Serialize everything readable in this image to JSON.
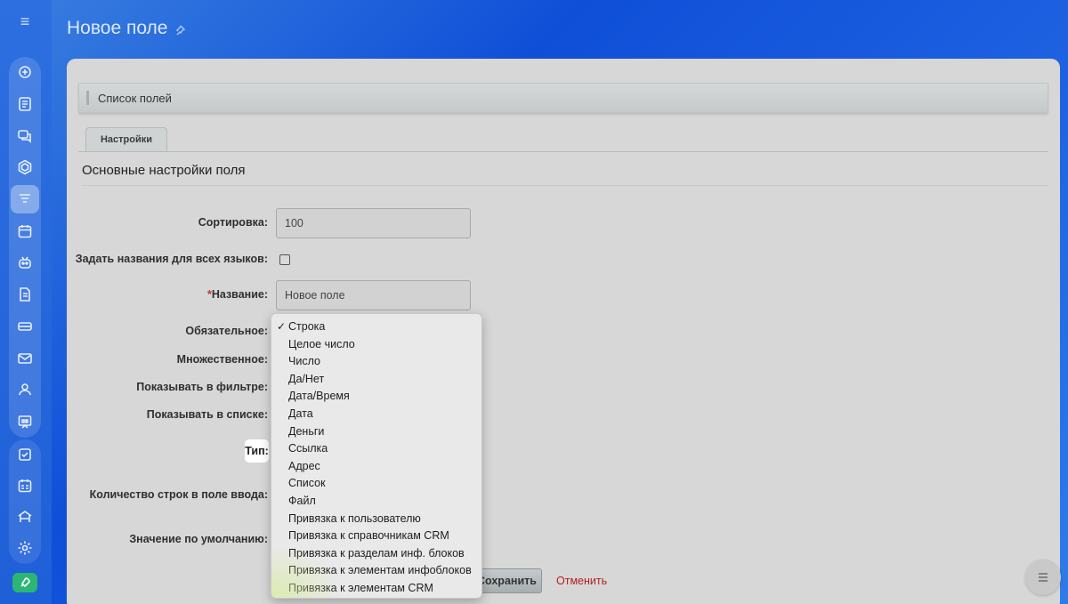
{
  "page": {
    "title": "Новое поле"
  },
  "breadcrumb": "Список полей",
  "tabs": [
    {
      "label": "Настройки"
    }
  ],
  "section_title": "Основные настройки поля",
  "form": {
    "sort_label": "Сортировка:",
    "sort_value": "100",
    "all_lang_label": "Задать названия для всех языков:",
    "name_required_mark": "*",
    "name_label": "Название:",
    "name_value": "Новое поле",
    "required_label": "Обязательное:",
    "multiple_label": "Множественное:",
    "show_filter_label": "Показывать в фильтре:",
    "show_list_label": "Показывать в списке:",
    "type_label": "Тип:",
    "rows_label": "Количество строк в поле ввода:",
    "default_label": "Значение по умолчанию:"
  },
  "actions": {
    "save_label": "Сохранить",
    "cancel_label": "Отменить"
  },
  "type_dropdown": {
    "selected_index": 0,
    "check_mark": "✓",
    "options": [
      "Строка",
      "Целое число",
      "Число",
      "Да/Нет",
      "Дата/Время",
      "Дата",
      "Деньги",
      "Ссылка",
      "Адрес",
      "Список",
      "Файл",
      "Привязка к пользователю",
      "Привязка к справочникам CRM",
      "Привязка к разделам инф. блоков",
      "Привязка к элементам инфоблоков",
      "Привязка к элементам CRM"
    ]
  },
  "sidebar": {
    "icons": [
      "menu-icon",
      "feed-icon",
      "tasks-icon",
      "chat-icon",
      "hexagon-icon",
      "filter-icon",
      "calendar-icon",
      "robot-icon",
      "document-icon",
      "drive-icon",
      "mail-icon",
      "contacts-icon",
      "presentation-icon",
      "checkbox-icon",
      "planner-icon",
      "store-icon",
      "settings-icon",
      "rocket-icon"
    ]
  }
}
